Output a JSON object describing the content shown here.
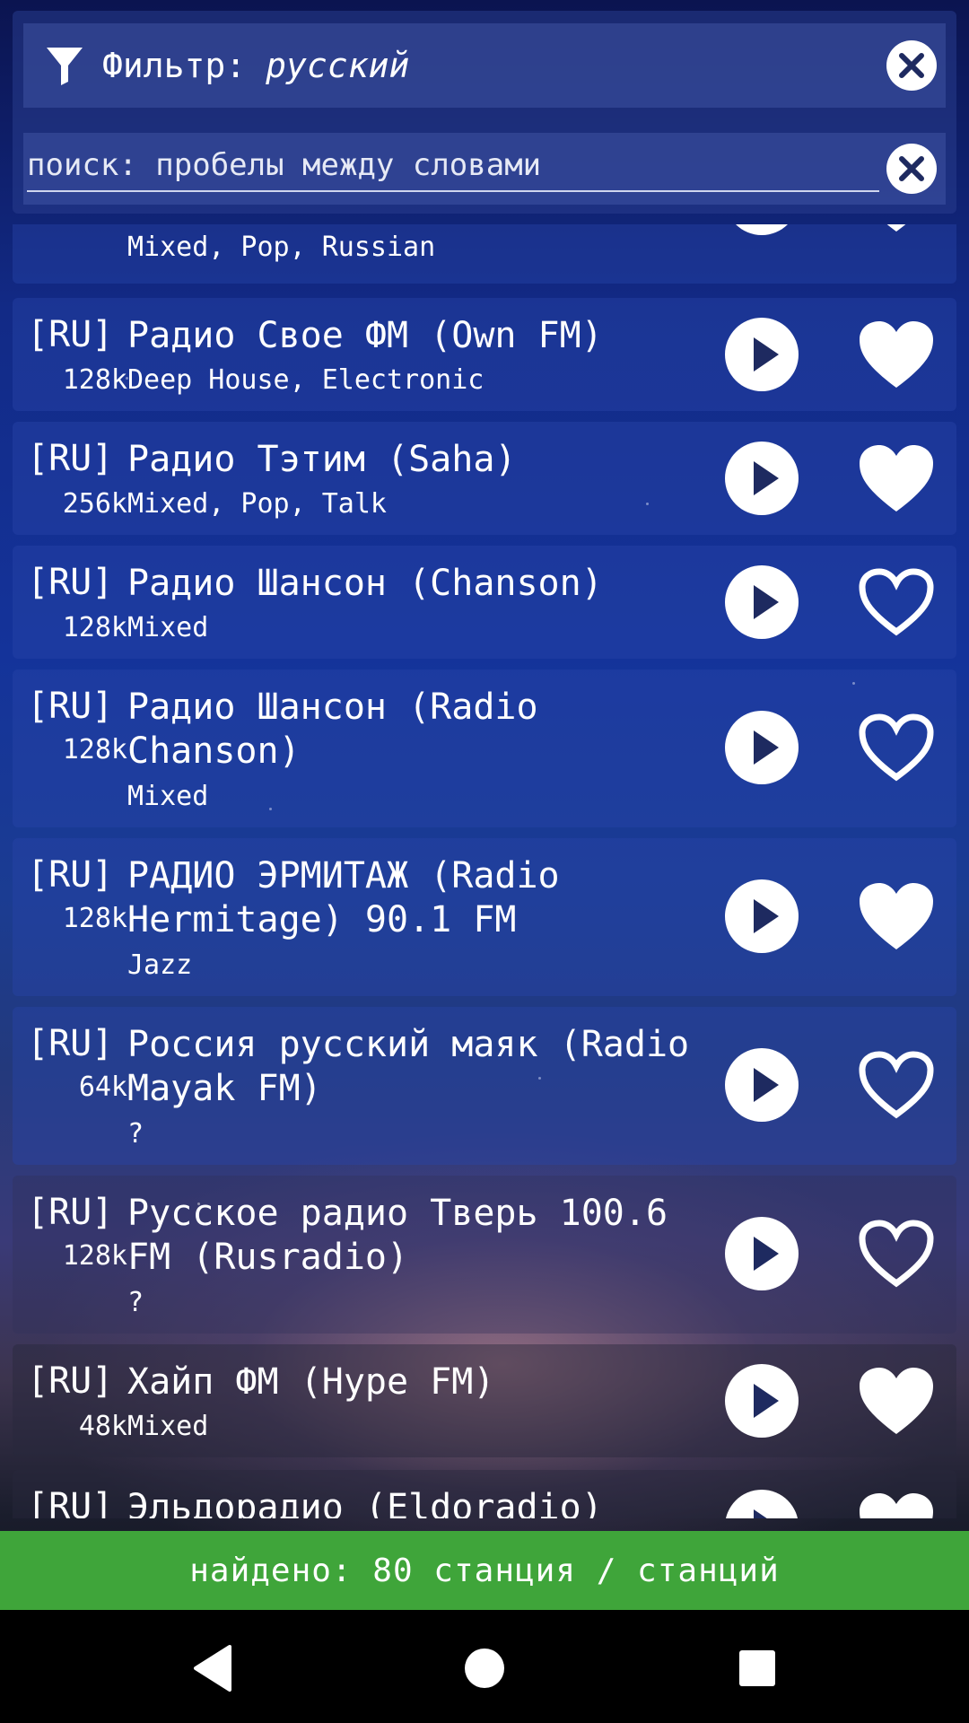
{
  "filter": {
    "label": "Фильтр:",
    "value": "русский"
  },
  "search": {
    "placeholder": "поиск: пробелы между словами"
  },
  "stations": [
    {
      "country": "",
      "bitrate": "",
      "name": "",
      "genre": "Mixed, Pop, Russian",
      "favorite": true,
      "partial": "top"
    },
    {
      "country": "[RU]",
      "bitrate": "128k",
      "name": "Радио Свое ФМ (Own FM)",
      "genre": "Deep House, Electronic",
      "favorite": true
    },
    {
      "country": "[RU]",
      "bitrate": "256k",
      "name": "Радио Тэтим (Saha)",
      "genre": "Mixed, Pop, Talk",
      "favorite": true
    },
    {
      "country": "[RU]",
      "bitrate": "128k",
      "name": "Радио Шансон (Chanson)",
      "genre": "Mixed",
      "favorite": false
    },
    {
      "country": "[RU]",
      "bitrate": "128k",
      "name": "Радио Шансон (Radio Chanson)",
      "genre": "Mixed",
      "favorite": false
    },
    {
      "country": "[RU]",
      "bitrate": "128k",
      "name": "РАДИО ЭРМИТАЖ (Radio Hermitage) 90.1 FM",
      "genre": "Jazz",
      "favorite": true
    },
    {
      "country": "[RU]",
      "bitrate": "64k",
      "name": "Россия русский маяк (Radio Mayak FM)",
      "genre": "?",
      "favorite": false
    },
    {
      "country": "[RU]",
      "bitrate": "128k",
      "name": "Русское радио Тверь 100.6 FM (Rusradio)",
      "genre": "?",
      "favorite": false
    },
    {
      "country": "[RU]",
      "bitrate": "48k",
      "name": "Хайп ФМ (Hype FM)",
      "genre": "Mixed",
      "favorite": true
    },
    {
      "country": "[RU]",
      "bitrate": "",
      "name": "Эльдорадио (Eldoradio)",
      "genre": "",
      "favorite": true,
      "partial": "bottom"
    }
  ],
  "status": {
    "text": "найдено: 80 станция / станций"
  },
  "colors": {
    "status_bar": "#3fa53a",
    "row_bg": "#2846aa",
    "nav_bar": "#000000"
  },
  "icons": {
    "filter": "filter-icon",
    "clear": "close-icon",
    "play": "play-icon",
    "favorite": "heart-icon",
    "back": "back-icon",
    "home": "home-icon",
    "recents": "recents-icon"
  }
}
